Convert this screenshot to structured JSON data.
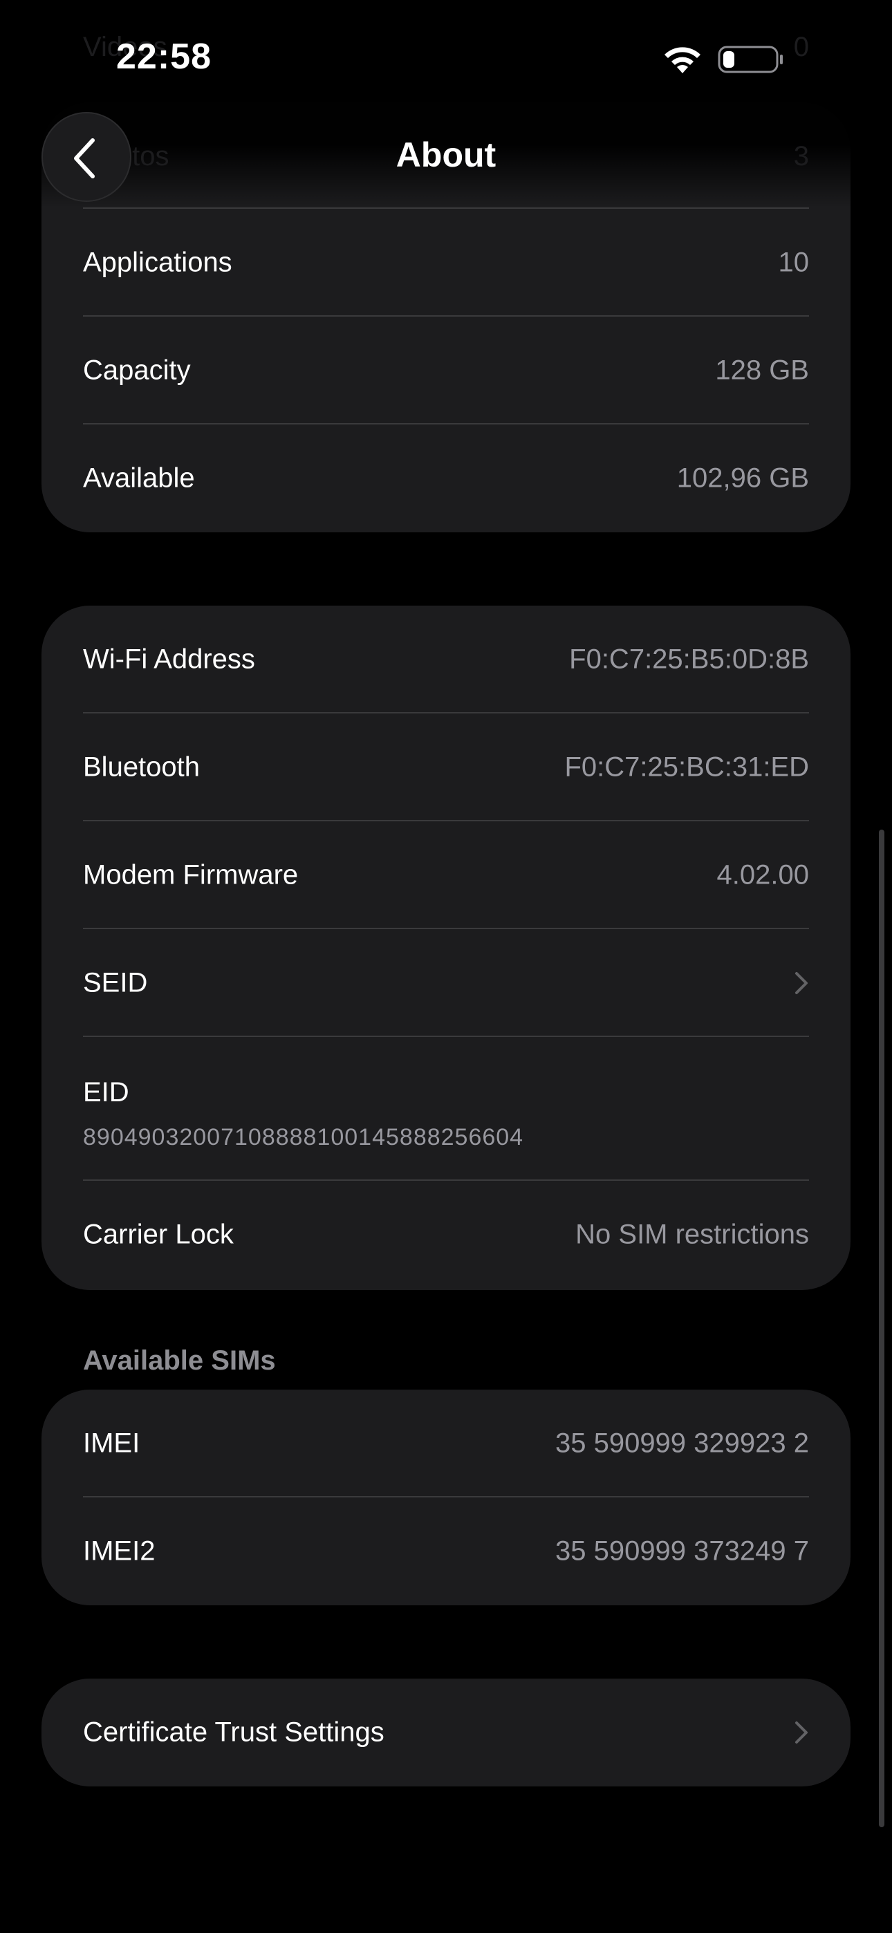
{
  "status_bar": {
    "time": "22:58"
  },
  "nav": {
    "title": "About",
    "ghost_rows": [
      {
        "label": "Videos",
        "value": "0"
      },
      {
        "label": "Photos",
        "value": "3"
      }
    ]
  },
  "groups": {
    "storage": [
      {
        "label": "Applications",
        "value": "10"
      },
      {
        "label": "Capacity",
        "value": "128 GB"
      },
      {
        "label": "Available",
        "value": "102,96 GB"
      }
    ],
    "network": {
      "wifi": {
        "label": "Wi-Fi Address",
        "value": "F0:C7:25:B5:0D:8B"
      },
      "bluetooth": {
        "label": "Bluetooth",
        "value": "F0:C7:25:BC:31:ED"
      },
      "modem": {
        "label": "Modem Firmware",
        "value": "4.02.00"
      },
      "seid": {
        "label": "SEID"
      },
      "eid": {
        "label": "EID",
        "value": "89049032007108888100145888256604"
      },
      "carrier_lock": {
        "label": "Carrier Lock",
        "value": "No SIM restrictions"
      }
    },
    "sims": {
      "header": "Available SIMs",
      "rows": [
        {
          "label": "IMEI",
          "value": "35 590999 329923 2"
        },
        {
          "label": "IMEI2",
          "value": "35 590999 373249 7"
        }
      ]
    },
    "certificate": {
      "label": "Certificate Trust Settings"
    }
  },
  "icons": {
    "back": "chevron-left-icon",
    "disclosure": "chevron-right-icon",
    "wifi": "wifi-icon",
    "battery": "battery-icon"
  },
  "colors": {
    "background": "#000000",
    "group_background": "#1c1c1e",
    "separator": "#3a3a3c",
    "primary_text": "#ffffff",
    "secondary_text": "#98989f"
  }
}
